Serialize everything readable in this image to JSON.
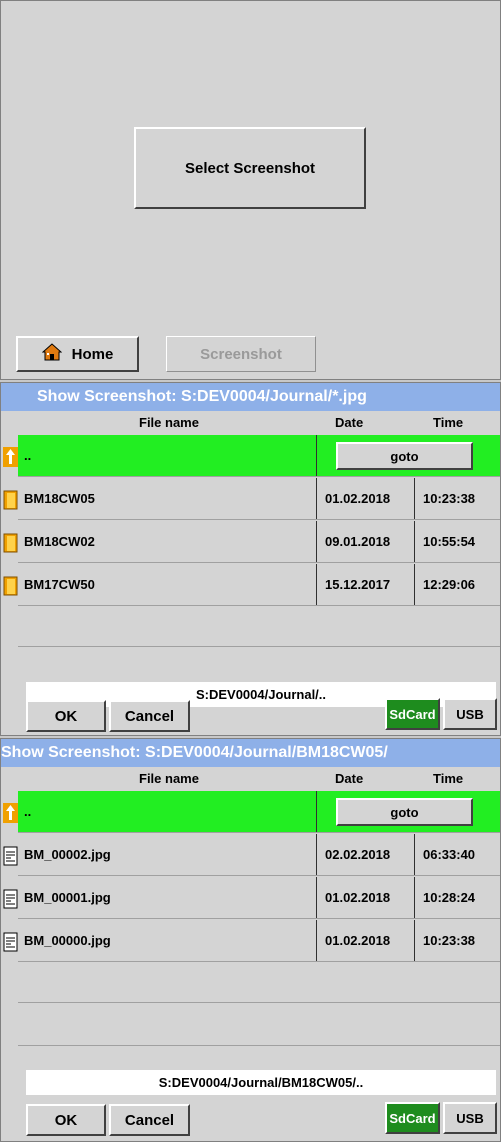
{
  "panel1": {
    "select_button": "Select Screenshot",
    "home_button": "Home",
    "screenshot_button": "Screenshot"
  },
  "panel2": {
    "title": "Show Screenshot:  S:DEV0004/Journal/*.jpg",
    "columns": {
      "name": "File name",
      "date": "Date",
      "time": "Time"
    },
    "up_row": {
      "name": "..",
      "goto": "goto"
    },
    "rows": [
      {
        "icon": "folder-icon",
        "name": "BM18CW05",
        "date": "01.02.2018",
        "time": "10:23:38"
      },
      {
        "icon": "folder-icon",
        "name": "BM18CW02",
        "date": "09.01.2018",
        "time": "10:55:54"
      },
      {
        "icon": "folder-icon",
        "name": "BM17CW50",
        "date": "15.12.2017",
        "time": "12:29:06"
      }
    ],
    "path": "S:DEV0004/Journal/..",
    "ok": "OK",
    "cancel": "Cancel",
    "sdcard": "SdCard",
    "usb": "USB"
  },
  "panel3": {
    "title": "Show Screenshot:  S:DEV0004/Journal/BM18CW05/",
    "columns": {
      "name": "File name",
      "date": "Date",
      "time": "Time"
    },
    "up_row": {
      "name": "..",
      "goto": "goto"
    },
    "rows": [
      {
        "icon": "image-file-icon",
        "name": "BM_00002.jpg",
        "date": "02.02.2018",
        "time": "06:33:40"
      },
      {
        "icon": "image-file-icon",
        "name": "BM_00001.jpg",
        "date": "01.02.2018",
        "time": "10:28:24"
      },
      {
        "icon": "image-file-icon",
        "name": "BM_00000.jpg",
        "date": "01.02.2018",
        "time": "10:23:38"
      }
    ],
    "path": "S:DEV0004/Journal/BM18CW05/..",
    "ok": "OK",
    "cancel": "Cancel",
    "sdcard": "SdCard",
    "usb": "USB"
  },
  "colors": {
    "title_bar": "#8eb0e8",
    "up_row": "#22ee22",
    "sdcard_active": "#1e8c1e",
    "panel_bg": "#d4d4d4"
  }
}
